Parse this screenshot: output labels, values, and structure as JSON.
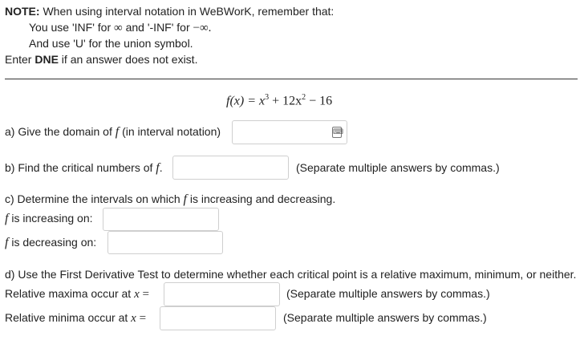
{
  "note": {
    "label": "NOTE:",
    "line1": " When using interval notation in WeBWorK, remember that:",
    "line2a": "You use 'INF' for ",
    "inf_symbol": "∞",
    "line2b": " and '-INF' for ",
    "neg_inf_symbol": "−∞.",
    "line3": "And use 'U' for the union symbol.",
    "line4a": "Enter ",
    "dne": "DNE",
    "line4b": " if an answer does not exist."
  },
  "function": {
    "lhs": "f(x) = x",
    "exp1": "3",
    "mid": " + 12x",
    "exp2": "2",
    "rhs": " − 16"
  },
  "part_a": {
    "prefix": "a) Give the domain of ",
    "f": "f",
    "suffix": " (in interval notation)",
    "value": "",
    "icon": "keyboard-icon"
  },
  "part_b": {
    "prefix": "b) Find the critical numbers of ",
    "f": "f",
    "suffix": ".",
    "value": "",
    "hint": "(Separate multiple answers by commas.)"
  },
  "part_c": {
    "prefix": "c) Determine the intervals on which ",
    "f": "f",
    "suffix": " is increasing and decreasing.",
    "inc_f": "f",
    "inc_label": " is increasing on:",
    "dec_f": "f",
    "dec_label": " is decreasing on:",
    "inc_value": "",
    "dec_value": ""
  },
  "part_d": {
    "text": "d) Use the First Derivative Test to determine whether each critical point is a relative maximum, minimum, or neither.",
    "max_label": "Relative maxima occur at ",
    "max_x": "x",
    "max_eq": " =",
    "max_value": "",
    "max_hint": "(Separate multiple answers by commas.)",
    "min_label": "Relative minima occur at ",
    "min_x": "x",
    "min_eq": " =",
    "min_value": "",
    "min_hint": "(Separate multiple answers by commas.)"
  }
}
